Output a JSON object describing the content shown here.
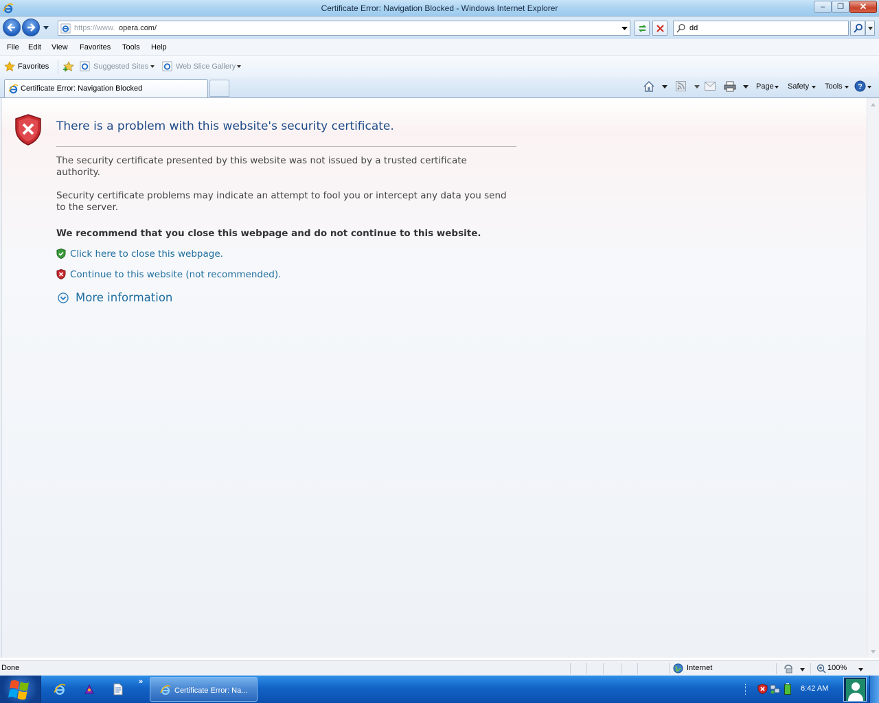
{
  "window": {
    "title": "Certificate Error: Navigation Blocked - Windows Internet Explorer",
    "minimize": "–",
    "maximize": "❐",
    "close": "✕"
  },
  "address_bar": {
    "protocol": "https://www.",
    "domain": "opera.com/",
    "search_value": "dd"
  },
  "menu": [
    "File",
    "Edit",
    "View",
    "Favorites",
    "Tools",
    "Help"
  ],
  "favorites_bar": {
    "favorites_label": "Favorites",
    "suggested_sites": "Suggested Sites",
    "web_slice_gallery": "Web Slice Gallery"
  },
  "tabs": {
    "active_label": "Certificate Error: Navigation Blocked"
  },
  "command_bar": {
    "page": "Page",
    "safety": "Safety",
    "tools": "Tools"
  },
  "content": {
    "heading": "There is a problem with this website's security certificate.",
    "para1": "The security certificate presented by this website was not issued by a trusted certificate authority.",
    "para2": "Security certificate problems may indicate an attempt to fool you or intercept any data you send to the server.",
    "recommendation": "We recommend that you close this webpage and do not continue to this website.",
    "close_link": "Click here to close this webpage.",
    "continue_link": "Continue to this website (not recommended).",
    "more_info": "More information"
  },
  "status_bar": {
    "status": "Done",
    "zone": "Internet",
    "zoom": "100%"
  },
  "taskbar": {
    "active_item": "Certificate Error: Na...",
    "clock": "6:42 AM"
  },
  "colors": {
    "heading": "#1f4c8a",
    "link": "#1f6e9e",
    "taskbar": "#1263c6",
    "error_red": "#c0272d",
    "safe_green": "#3a9a3a"
  }
}
